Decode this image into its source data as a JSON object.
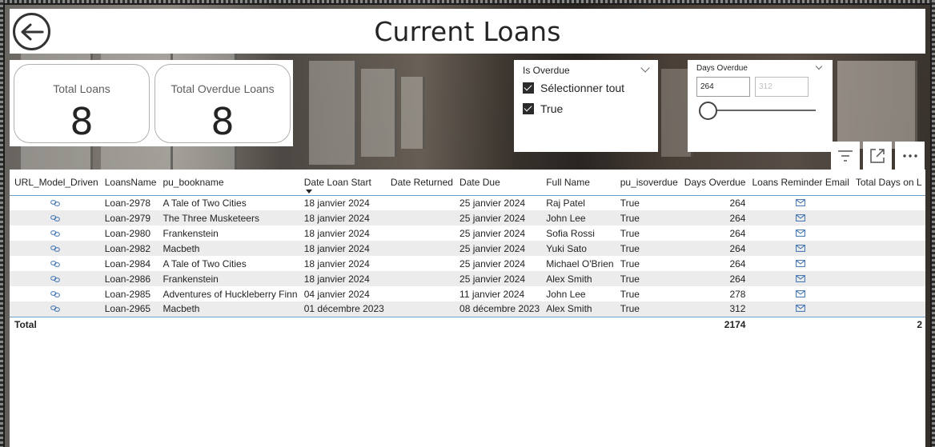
{
  "header": {
    "title": "Current Loans",
    "back_icon": "arrow-left-circle-icon"
  },
  "cards": [
    {
      "label": "Total Loans",
      "value": "8"
    },
    {
      "label": "Total Overdue Loans",
      "value": "8"
    }
  ],
  "slicer_overdue": {
    "title": "Is Overdue",
    "options": [
      {
        "label": "Sélectionner tout",
        "checked": true
      },
      {
        "label": "True",
        "checked": true
      }
    ]
  },
  "slicer_days": {
    "title": "Days Overdue",
    "min_value": "264",
    "max_placeholder": "312"
  },
  "toolbar": {
    "filter_icon": "filter-icon",
    "focus_icon": "focus-mode-icon",
    "more_icon": "more-options-icon"
  },
  "table": {
    "columns": [
      "URL_Model_Driven",
      "LoansName",
      "pu_bookname",
      "Date Loan Start",
      "Date Returned",
      "Date Due",
      "Full Name",
      "pu_isoverdue",
      "Days Overdue",
      "Loans Reminder Email",
      "Total Days on L"
    ],
    "rows": [
      {
        "loan": "Loan-2978",
        "book": "A Tale of Two Cities",
        "start": "18 janvier 2024",
        "returned": "",
        "due": "25 janvier 2024",
        "name": "Raj Patel",
        "overdue": "True",
        "days": "264"
      },
      {
        "loan": "Loan-2979",
        "book": "The Three Musketeers",
        "start": "18 janvier 2024",
        "returned": "",
        "due": "25 janvier 2024",
        "name": "John Lee",
        "overdue": "True",
        "days": "264"
      },
      {
        "loan": "Loan-2980",
        "book": "Frankenstein",
        "start": "18 janvier 2024",
        "returned": "",
        "due": "25 janvier 2024",
        "name": "Sofia Rossi",
        "overdue": "True",
        "days": "264"
      },
      {
        "loan": "Loan-2982",
        "book": "Macbeth",
        "start": "18 janvier 2024",
        "returned": "",
        "due": "25 janvier 2024",
        "name": "Yuki Sato",
        "overdue": "True",
        "days": "264"
      },
      {
        "loan": "Loan-2984",
        "book": "A Tale of Two Cities",
        "start": "18 janvier 2024",
        "returned": "",
        "due": "25 janvier 2024",
        "name": "Michael O'Brien",
        "overdue": "True",
        "days": "264"
      },
      {
        "loan": "Loan-2986",
        "book": "Frankenstein",
        "start": "18 janvier 2024",
        "returned": "",
        "due": "25 janvier 2024",
        "name": "Alex Smith",
        "overdue": "True",
        "days": "264"
      },
      {
        "loan": "Loan-2985",
        "book": "Adventures of Huckleberry Finn",
        "start": "04 janvier 2024",
        "returned": "",
        "due": "11 janvier 2024",
        "name": "John Lee",
        "overdue": "True",
        "days": "278"
      },
      {
        "loan": "Loan-2965",
        "book": "Macbeth",
        "start": "01 décembre 2023",
        "returned": "",
        "due": "08 décembre 2023",
        "name": "Alex Smith",
        "overdue": "True",
        "days": "312"
      }
    ],
    "total_label": "Total",
    "total_days": "2174",
    "total_days_on_loan": "2"
  }
}
